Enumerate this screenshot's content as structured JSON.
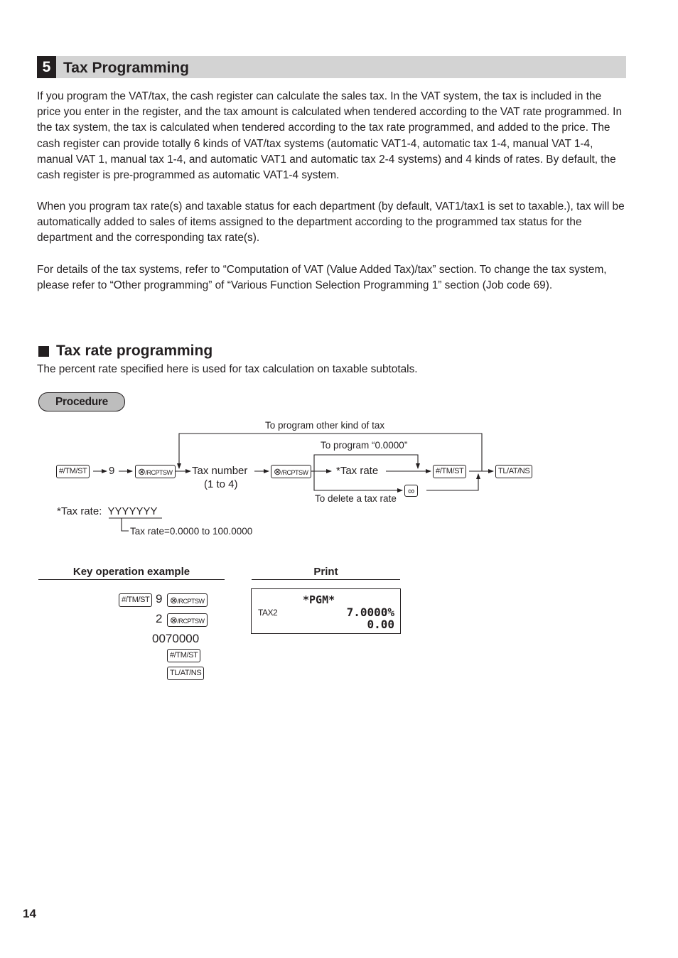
{
  "section": {
    "number": "5",
    "title": "Tax Programming"
  },
  "paragraphs": [
    "If you program the VAT/tax, the cash register can calculate the sales tax. In the VAT system, the tax is included in the price you enter in the register, and the tax amount is calculated when tendered according to the VAT rate programmed. In the tax system, the tax is calculated when tendered according to the tax rate programmed, and added to the price. The cash register can provide totally 6 kinds of VAT/tax systems (automatic VAT1-4, automatic tax 1-4, manual VAT 1-4, manual VAT 1, manual tax 1-4, and automatic VAT1 and automatic tax 2-4 systems) and 4 kinds of rates. By default, the cash register is pre-programmed as automatic VAT1-4 system.",
    "When you program tax rate(s) and taxable status for each department (by default, VAT1/tax1 is set to taxable.), tax will be automatically added to sales of items assigned to the department according to the programmed tax status for the department and the corresponding tax rate(s).",
    "For details of the tax systems, refer to “Computation of VAT (Value Added Tax)/tax” section. To change the tax system, please refer to “Other programming” of “Various Function Selection Programming 1” section (Job code 69)."
  ],
  "subsection": {
    "title": "Tax rate programming",
    "description": "The percent rate specified here is used for tax calculation on taxable subtotals."
  },
  "procedure": {
    "label": "Procedure",
    "keys": {
      "tm_st": "#/TM/ST",
      "rcptsw_symbol": "⊗",
      "rcptsw_text": "/RCPTSW",
      "tl_at_ns": "TL/AT/NS",
      "cl_symbol": "∞"
    },
    "digit_9": "9",
    "tax_number": "Tax number",
    "tax_number_range": "(1 to 4)",
    "tax_rate": "*Tax rate",
    "loop_label": "To program other kind of tax",
    "zero_label": "To program “0.0000”",
    "delete_label": "To delete a tax rate",
    "note_prefix": "*Tax rate: ",
    "note_format": "YYYYYYY",
    "note_range": "Tax rate=0.0000 to 100.0000"
  },
  "example": {
    "key_header": "Key operation example",
    "print_header": "Print",
    "steps": {
      "row1_digit": "9",
      "row2_digit": "2",
      "row3_value": "0070000"
    },
    "printout": {
      "line1": "*PGM*",
      "label": "TAX2",
      "rate": "7.0000%",
      "amount": "0.00"
    }
  },
  "page_number": "14"
}
